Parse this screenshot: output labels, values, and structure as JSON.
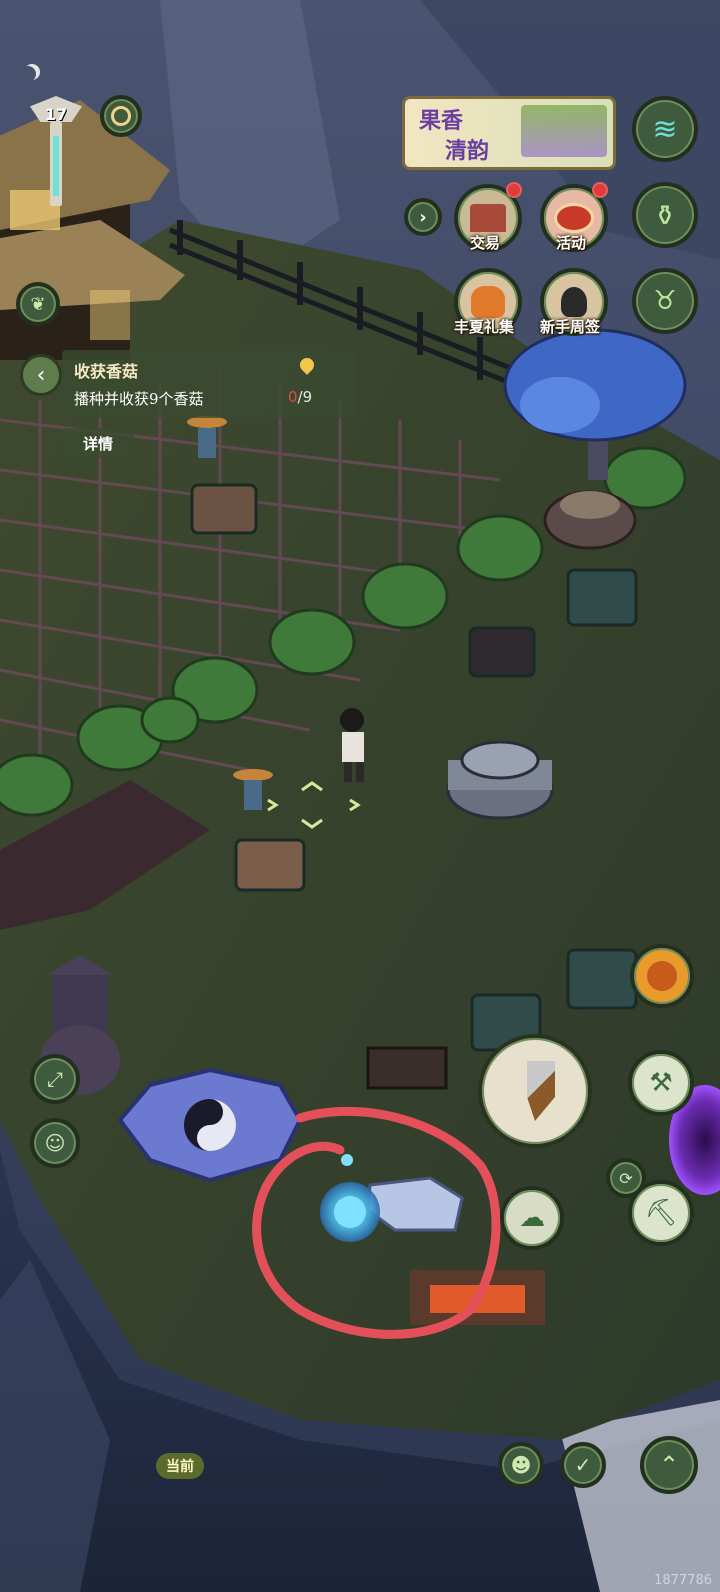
{
  "hud": {
    "level": "17",
    "event_banner": {
      "line1": "果香",
      "line2": "清韵"
    },
    "menu": {
      "trade": "交易",
      "activity": "活动",
      "summer_gift": "丰夏礼集",
      "newbie_checkin": "新手周签"
    },
    "current_label": "当前",
    "watermark": "1877786"
  },
  "quest": {
    "title": "收获香菇",
    "description": "播种并收获9个香菇",
    "progress_current": "0",
    "progress_total": "/9",
    "details_label": "详情"
  },
  "colors": {
    "button_green": "#3f5b3d",
    "highlight_circle": "#e4505a",
    "notification": "#e03a3a",
    "quest_panel": "#3a4a30"
  },
  "icons": [
    "moon-icon",
    "compass-icon",
    "leaf-icon",
    "wave-icon",
    "pot-icon",
    "bull-icon",
    "arrow-right-icon",
    "trade-stall-icon",
    "drum-icon",
    "gift-bag-icon",
    "avatar-icon",
    "location-pin-icon",
    "expand-icon",
    "person-icon",
    "axe-icon",
    "pickaxe-icon",
    "hoe-icon",
    "cycle-icon",
    "cloud-icon",
    "smile-icon",
    "check-icon",
    "up-arrow-icon",
    "spirit-orb-icon"
  ]
}
